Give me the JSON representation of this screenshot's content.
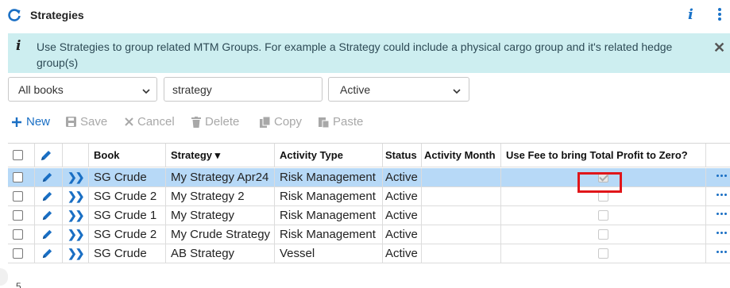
{
  "header": {
    "title": "Strategies"
  },
  "notice": {
    "icon": "info-icon",
    "text": "Use Strategies to group related MTM Groups. For example a Strategy could include a physical cargo group and it's related hedge group(s)"
  },
  "filters": {
    "books": "All books",
    "search": "strategy",
    "status": "Active"
  },
  "toolbar": {
    "new": "New",
    "save": "Save",
    "cancel": "Cancel",
    "delete": "Delete",
    "copy": "Copy",
    "paste": "Paste"
  },
  "table": {
    "columns": {
      "book": "Book",
      "strategy": "Strategy ▾",
      "activity_type": "Activity Type",
      "status": "Status",
      "activity_month": "Activity Month",
      "use_fee": "Use Fee to bring Total Profit to Zero?"
    },
    "rows": [
      {
        "book": "SG Crude",
        "strategy": "My Strategy Apr24",
        "activity_type": "Risk Management",
        "status": "Active",
        "activity_month": "",
        "use_fee": true
      },
      {
        "book": "SG Crude 2",
        "strategy": "My Strategy 2",
        "activity_type": "Risk Management",
        "status": "Active",
        "activity_month": "",
        "use_fee": false
      },
      {
        "book": "SG Crude 1",
        "strategy": "My Strategy",
        "activity_type": "Risk Management",
        "status": "Active",
        "activity_month": "",
        "use_fee": false
      },
      {
        "book": "SG Crude 2",
        "strategy": "My Crude Strategy",
        "activity_type": "Risk Management",
        "status": "Active",
        "activity_month": "",
        "use_fee": false
      },
      {
        "book": "SG Crude",
        "strategy": "AB Strategy",
        "activity_type": "Vessel",
        "status": "Active",
        "activity_month": "",
        "use_fee": false
      }
    ]
  },
  "footer": {
    "count": "5"
  },
  "colors": {
    "accent": "#1a6fc4",
    "selected_row": "#b7d9f7",
    "notice_bg": "#cdeef0",
    "highlight": "#e0161a"
  }
}
